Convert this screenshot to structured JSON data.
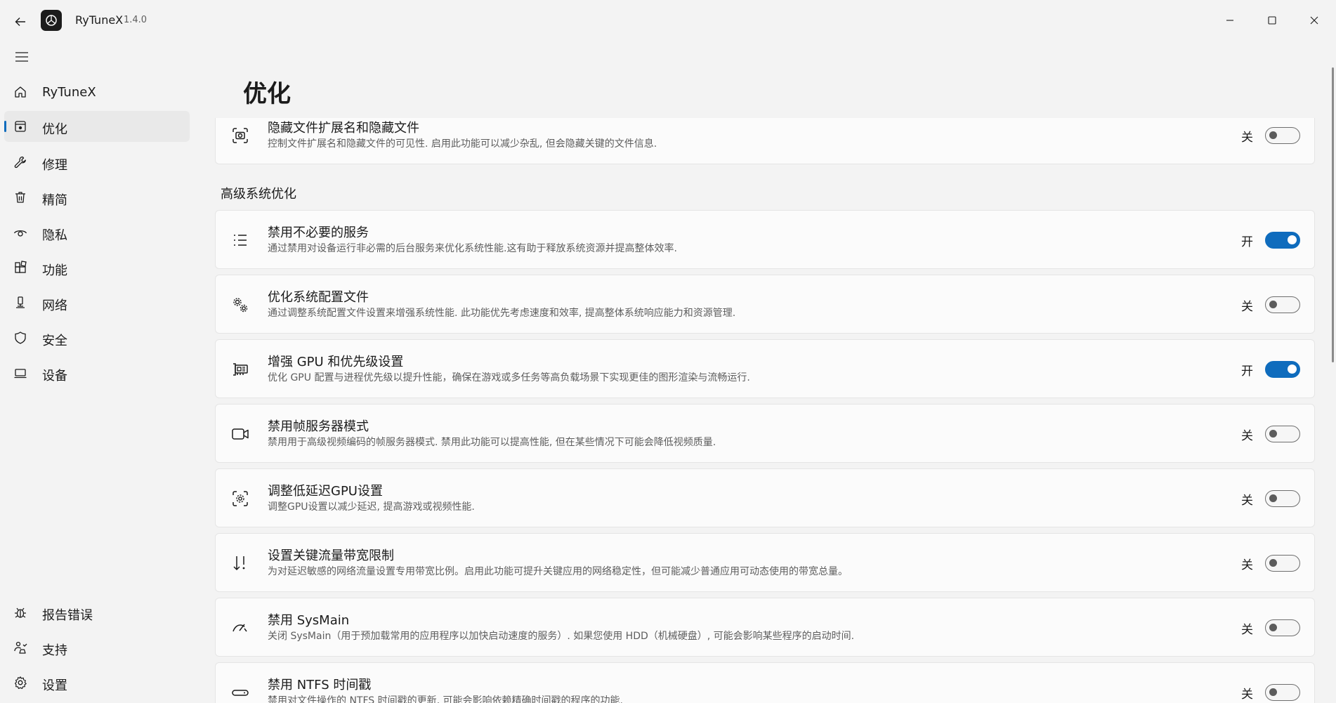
{
  "window": {
    "app_name": "RyTuneX",
    "version": "1.4.0"
  },
  "sidebar": {
    "items": [
      {
        "label": "RyTuneX",
        "icon": "home-icon"
      },
      {
        "label": "优化",
        "icon": "optimize-icon",
        "selected": true
      },
      {
        "label": "修理",
        "icon": "wrench-icon"
      },
      {
        "label": "精简",
        "icon": "trash-icon"
      },
      {
        "label": "隐私",
        "icon": "eye-icon"
      },
      {
        "label": "功能",
        "icon": "apps-icon"
      },
      {
        "label": "网络",
        "icon": "network-icon"
      },
      {
        "label": "安全",
        "icon": "shield-icon"
      },
      {
        "label": "设备",
        "icon": "laptop-icon"
      }
    ],
    "footer_items": [
      {
        "label": "报告错误",
        "icon": "bug-icon"
      },
      {
        "label": "支持",
        "icon": "support-icon"
      },
      {
        "label": "设置",
        "icon": "gear-icon"
      }
    ]
  },
  "page": {
    "title": "优化",
    "section_advanced": "高级系统优化"
  },
  "settings": [
    {
      "title": "隐藏文件扩展名和隐藏文件",
      "desc": "控制文件扩展名和隐藏文件的可见性. 启用此功能可以减少杂乱, 但会隐藏关键的文件信息.",
      "state": "关",
      "on": false,
      "icon": "camera-scan-icon"
    },
    {
      "title": "禁用不必要的服务",
      "desc": "通过禁用对设备运行非必需的后台服务来优化系统性能.这有助于释放系统资源并提高整体效率.",
      "state": "开",
      "on": true,
      "icon": "list-icon"
    },
    {
      "title": "优化系统配置文件",
      "desc": "通过调整系统配置文件设置来增强系统性能. 此功能优先考虑速度和效率, 提高整体系统响应能力和资源管理.",
      "state": "关",
      "on": false,
      "icon": "gears-icon"
    },
    {
      "title": "增强 GPU 和优先级设置",
      "desc": "优化 GPU 配置与进程优先级以提升性能，确保在游戏或多任务等高负载场景下实现更佳的图形渲染与流畅运行.",
      "state": "开",
      "on": true,
      "icon": "gpu-icon"
    },
    {
      "title": "禁用帧服务器模式",
      "desc": "禁用用于高级视频编码的帧服务器模式. 禁用此功能可以提高性能, 但在某些情况下可能会降低视频质量.",
      "state": "关",
      "on": false,
      "icon": "video-icon"
    },
    {
      "title": "调整低延迟GPU设置",
      "desc": "调整GPU设置以减少延迟, 提高游戏或视频性能.",
      "state": "关",
      "on": false,
      "icon": "gpu-adjust-icon"
    },
    {
      "title": "设置关键流量带宽限制",
      "desc": "为对延迟敏感的网络流量设置专用带宽比例。启用此功能可提升关键应用的网络稳定性，但可能减少普通应用可动态使用的带宽总量。",
      "state": "关",
      "on": false,
      "icon": "bandwidth-icon"
    },
    {
      "title": "禁用 SysMain",
      "desc": "关闭 SysMain（用于预加载常用的应用程序以加快启动速度的服务）. 如果您使用 HDD（机械硬盘）, 可能会影响某些程序的启动时间.",
      "state": "关",
      "on": false,
      "icon": "speed-icon"
    },
    {
      "title": "禁用 NTFS 时间戳",
      "desc": "禁用对文件操作的 NTFS 时间戳的更新, 可能会影响依赖精确时间戳的程序的功能.",
      "state": "关",
      "on": false,
      "icon": "drive-icon"
    }
  ]
}
